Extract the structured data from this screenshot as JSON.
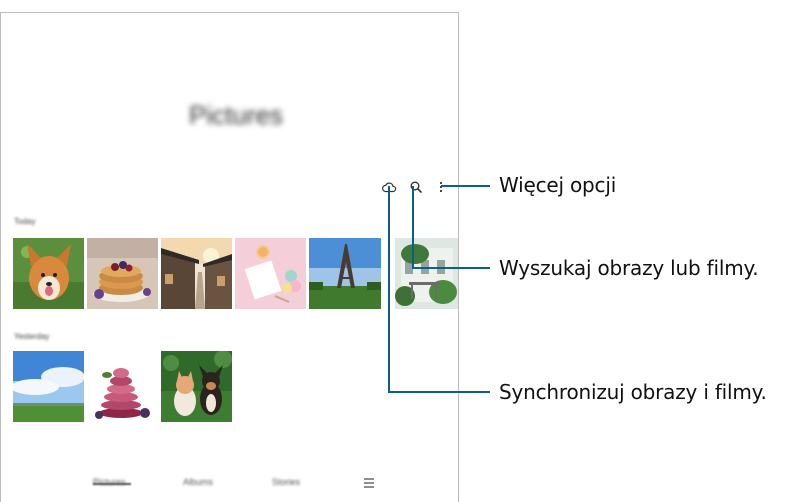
{
  "app": {
    "title": "Pictures",
    "sections": [
      {
        "label": "Today"
      },
      {
        "label": "Yesterday"
      }
    ],
    "toolbar": {
      "sync_icon": "cloud-icon",
      "search_icon": "search-icon",
      "more_icon": "more-options-icon"
    },
    "tabs": [
      {
        "label": "Pictures"
      },
      {
        "label": "Albums"
      },
      {
        "label": "Stories"
      }
    ],
    "menu_icon": "menu-icon"
  },
  "callouts": {
    "more_options": "Więcej opcji",
    "search": "Wyszukaj obrazy lub filmy.",
    "sync": "Synchronizuj obrazy i filmy."
  },
  "colors": {
    "leader_line": "#0a5f8c",
    "frame_border": "#bdbdbd"
  }
}
